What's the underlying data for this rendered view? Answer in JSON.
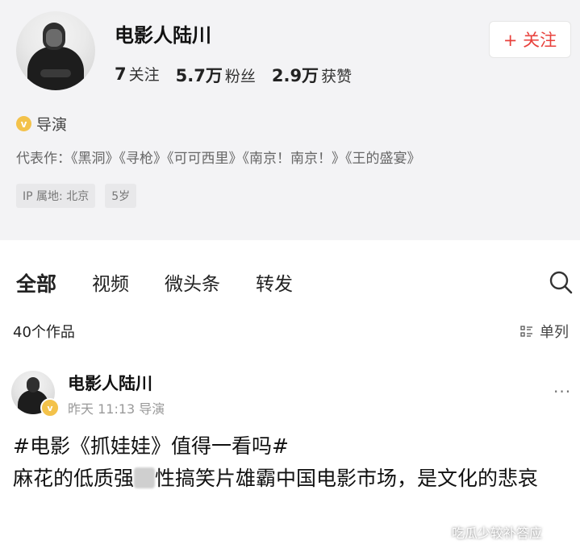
{
  "profile": {
    "name": "电影人陆川",
    "follow_button": "+ 关注",
    "stats": [
      {
        "value": "7",
        "label": "关注"
      },
      {
        "value": "5.7万",
        "label": "粉丝"
      },
      {
        "value": "2.9万",
        "label": "获赞"
      }
    ],
    "verified_title": "导演",
    "representative_works": "代表作：《黑洞》《寻枪》《可可西里》《南京！南京！》《王的盛宴》",
    "tags": [
      "IP 属地: 北京",
      "5岁"
    ]
  },
  "tabs": [
    "全部",
    "视频",
    "微头条",
    "转发"
  ],
  "works_count": "40个作品",
  "view_toggle": "单列",
  "post": {
    "author": "电影人陆川",
    "meta": "昨天 11:13 导演",
    "line1": "#电影《抓娃娃》值得一看吗#",
    "line2_part1": "麻花的低质强",
    "line2_part2": "性搞笑片雄霸中国电影市场，是文化的悲哀"
  },
  "watermark": "吃瓜少较补答应",
  "icons": {
    "search": "search-icon",
    "list": "list-view-icon",
    "more": "more-dots-icon",
    "verified": "verified-badge-icon"
  },
  "colors": {
    "accent": "#e8413c",
    "badge": "#f3c24a",
    "header_bg": "#f3f3f5"
  }
}
